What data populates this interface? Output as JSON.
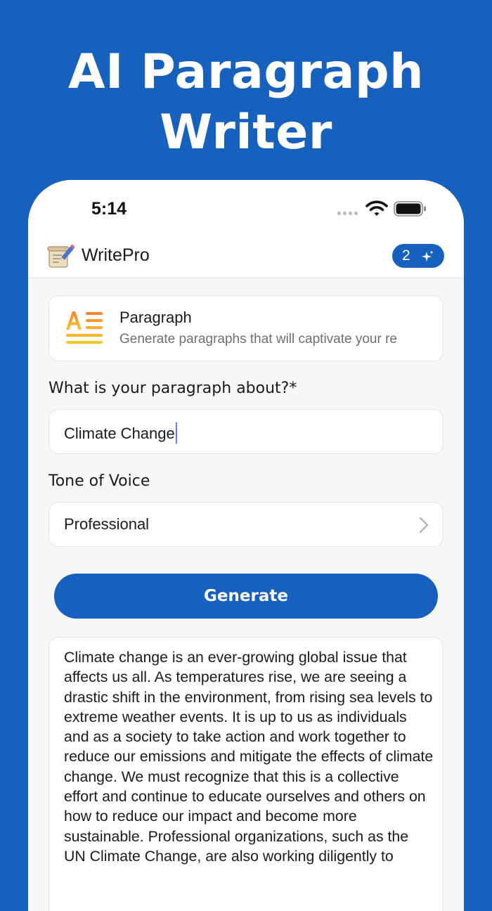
{
  "promo": {
    "title_line1": "AI Paragraph",
    "title_line2": "Writer"
  },
  "status_bar": {
    "time": "5:14"
  },
  "header": {
    "app_name": "WritePro",
    "credits": "2"
  },
  "tool": {
    "title": "Paragraph",
    "description": "Generate paragraphs that will captivate your re"
  },
  "form": {
    "topic_label": "What is your paragraph about?*",
    "topic_value": "Climate Change",
    "tone_label": "Tone of Voice",
    "tone_value": "Professional",
    "generate_label": "Generate"
  },
  "output": {
    "text": "Climate change is an ever-growing global issue that affects us all. As temperatures rise, we are seeing a drastic shift in the environment, from rising sea levels to extreme weather events. It is up to us as individuals and as a society to take action and work together to reduce our emissions and mitigate the effects of climate change. We must recognize that this is a collective effort and continue to educate ourselves and others on how to reduce our impact and become more sustainable. Professional organizations, such as the UN Climate Change, are also working diligently to"
  },
  "colors": {
    "brand": "#1660be",
    "background": "#f7f7f8",
    "card": "#ffffff"
  },
  "icons": {
    "logo": "scroll-pencil-icon",
    "credits": "sparkle-icon",
    "tool": "text-align-icon",
    "select": "chevron-right-icon"
  }
}
